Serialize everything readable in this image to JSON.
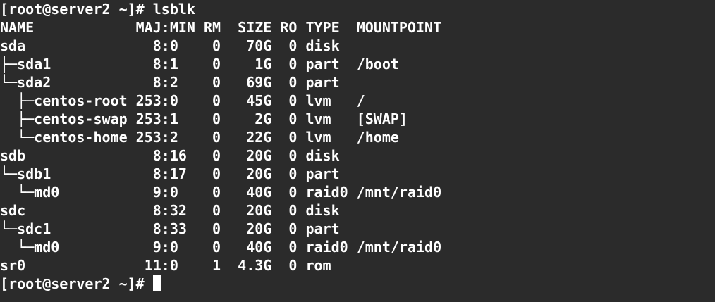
{
  "window": {
    "prompt_start": "[root@server2 ~]# lsblk",
    "prompt_end": "[root@server2 ~]#"
  },
  "terminal": {
    "lines": [
      "NAME            MAJ:MIN RM  SIZE RO TYPE  MOUNTPOINT",
      "sda               8:0    0   70G  0 disk",
      "├─sda1            8:1    0    1G  0 part  /boot",
      "└─sda2            8:2    0   69G  0 part",
      "  ├─centos-root 253:0    0   45G  0 lvm   /",
      "  ├─centos-swap 253:1    0    2G  0 lvm   [SWAP]",
      "  └─centos-home 253:2    0   22G  0 lvm   /home",
      "sdb               8:16   0   20G  0 disk",
      "└─sdb1            8:17   0   20G  0 part",
      "  └─md0           9:0    0   40G  0 raid0 /mnt/raid0",
      "sdc               8:32   0   20G  0 disk",
      "└─sdc1            8:33   0   20G  0 part",
      "  └─md0           9:0    0   40G  0 raid0 /mnt/raid0",
      "sr0              11:0    1  4.3G  0 rom"
    ]
  },
  "colors": {
    "background": "#2b2b2b",
    "foreground": "#ffffff"
  }
}
